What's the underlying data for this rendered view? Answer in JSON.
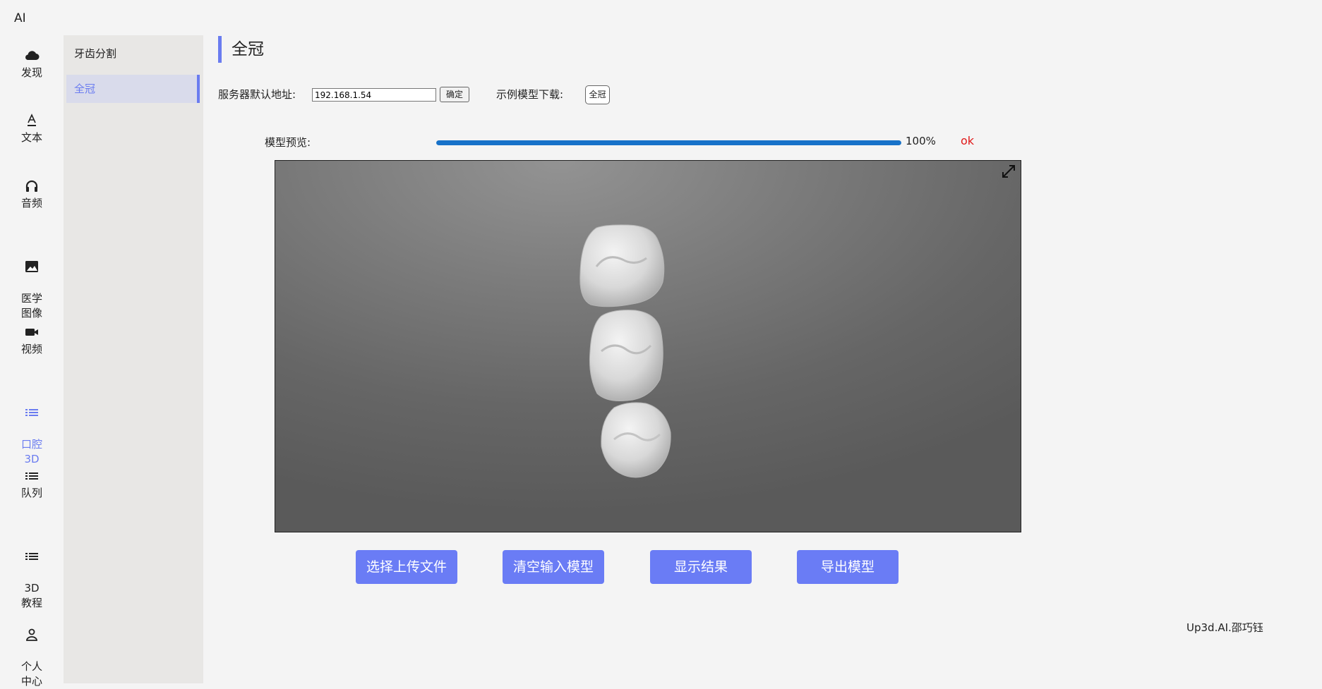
{
  "app": {
    "title": "AI"
  },
  "rail": {
    "items": [
      {
        "label": "发现",
        "icon": "cloud-icon",
        "active": false
      },
      {
        "label": "文本",
        "icon": "text-icon",
        "active": false
      },
      {
        "label": "音频",
        "icon": "headphones-icon",
        "active": false
      },
      {
        "label": "医学\n图像",
        "icon": "image-icon",
        "active": false
      },
      {
        "label": "视频",
        "icon": "video-camera-icon",
        "active": false
      },
      {
        "label": "口腔\n3D",
        "icon": "list-icon",
        "active": true
      },
      {
        "label": "队列",
        "icon": "list-icon",
        "active": false
      },
      {
        "label": "3D\n教程",
        "icon": "list-icon",
        "active": false
      },
      {
        "label": "个人\n中心",
        "icon": "user-icon",
        "active": false
      }
    ]
  },
  "submenu": {
    "items": [
      {
        "label": "牙齿分割",
        "active": false
      },
      {
        "label": "全冠",
        "active": true
      }
    ]
  },
  "page": {
    "title": "全冠"
  },
  "server": {
    "label": "服务器默认地址:",
    "value": "192.168.1.54",
    "confirm_label": "确定"
  },
  "demo": {
    "label": "示例模型下载:",
    "button_label": "全冠"
  },
  "preview": {
    "label": "模型预览:",
    "progress": 100,
    "progress_text": "100%",
    "status": "ok"
  },
  "viewer": {
    "expand_icon": "expand-icon",
    "background_top": "#939393",
    "background_bottom": "#5a5a5a"
  },
  "actions": {
    "upload": "选择上传文件",
    "clear": "清空输入模型",
    "show": "显示结果",
    "export": "导出模型"
  },
  "footer": {
    "text": "Up3d.AI.邵巧钰"
  },
  "colors": {
    "accent": "#6a7cf0",
    "progress": "#1772c9",
    "status": "#e01818",
    "button": "#6a7cf5"
  }
}
